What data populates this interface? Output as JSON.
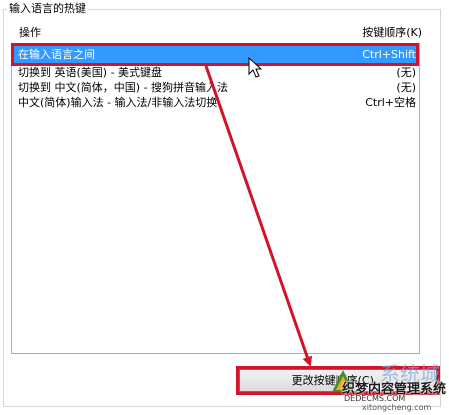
{
  "group": {
    "title": "输入语言的热键"
  },
  "columns": {
    "action": "操作",
    "sequence": "按键顺序(K)"
  },
  "hotkeys": [
    {
      "action": "在输入语言之间",
      "keys": "Ctrl+Shift",
      "selected": true
    },
    {
      "action": "切换到 英语(美国) - 美式键盘",
      "keys": "(无)",
      "selected": false
    },
    {
      "action": "切换到 中文(简体，中国) - 搜狗拼音输入法",
      "keys": "(无)",
      "selected": false
    },
    {
      "action": "中文(简体)输入法 - 输入法/非输入法切换",
      "keys": "Ctrl+空格",
      "selected": false
    }
  ],
  "change_button": {
    "label": "更改按键顺序(C)..."
  },
  "watermark": {
    "brand": "系统城",
    "line1": "织梦内容管理系统",
    "line2": "DEDECMS.COM",
    "line3": "xitongcheng.com"
  },
  "colors": {
    "selection": "#3399ff",
    "annotation": "#d0142a"
  }
}
